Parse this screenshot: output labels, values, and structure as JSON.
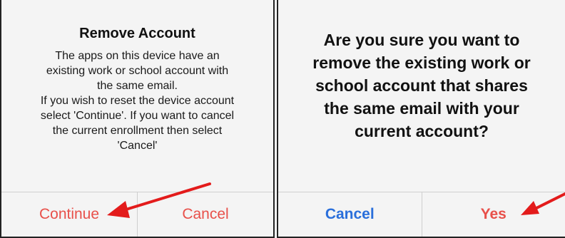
{
  "left_dialog": {
    "title": "Remove Account",
    "message_lines": [
      "The apps on this device have an",
      "existing work or school account with",
      "the same email.",
      "If you wish to reset the device account",
      "select 'Continue'. If you want to cancel",
      "the current enrollment then select",
      "'Cancel'"
    ],
    "continue_label": "Continue",
    "cancel_label": "Cancel"
  },
  "right_dialog": {
    "question_lines": [
      "Are you sure you want to",
      "remove the existing work or",
      "school account that shares",
      "the same email with your",
      "current account?"
    ],
    "cancel_label": "Cancel",
    "yes_label": "Yes"
  },
  "colors": {
    "destructive": "#e8504a",
    "primary": "#2a6fdb",
    "arrow": "#e31b1b"
  }
}
